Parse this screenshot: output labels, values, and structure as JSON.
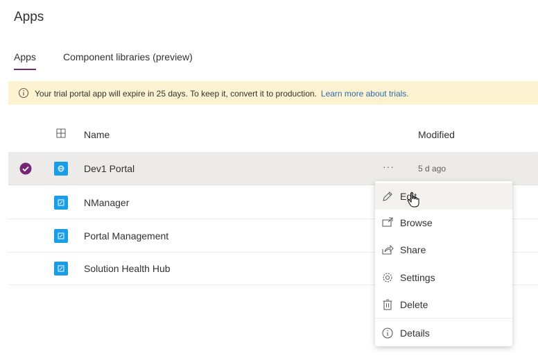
{
  "page": {
    "title": "Apps"
  },
  "tabs": [
    {
      "label": "Apps",
      "active": true
    },
    {
      "label": "Component libraries (preview)",
      "active": false
    }
  ],
  "banner": {
    "message": "Your trial portal app will expire in 25 days. To keep it, convert it to production.",
    "link": "Learn more about trials.",
    "icon": "info-icon"
  },
  "table": {
    "columns": {
      "name": "Name",
      "modified": "Modified"
    },
    "rows": [
      {
        "name": "Dev1 Portal",
        "modified": "5 d ago",
        "selected": true,
        "icon": "globe-app-icon"
      },
      {
        "name": "NManager",
        "modified": "",
        "selected": false,
        "icon": "app-icon"
      },
      {
        "name": "Portal Management",
        "modified": "",
        "selected": false,
        "icon": "app-icon"
      },
      {
        "name": "Solution Health Hub",
        "modified": "",
        "selected": false,
        "icon": "app-icon"
      }
    ],
    "more_label": "···"
  },
  "context_menu": {
    "items": [
      {
        "label": "Edit",
        "icon": "pencil-icon"
      },
      {
        "label": "Browse",
        "icon": "browse-icon"
      },
      {
        "label": "Share",
        "icon": "share-icon"
      },
      {
        "label": "Settings",
        "icon": "gear-icon"
      },
      {
        "label": "Delete",
        "icon": "trash-icon"
      },
      {
        "label": "Details",
        "icon": "info-icon"
      }
    ]
  },
  "colors": {
    "accent": "#742774",
    "banner": "#fdf3d0",
    "app_icon": "#1a9de8",
    "link": "#2b6cb0"
  }
}
